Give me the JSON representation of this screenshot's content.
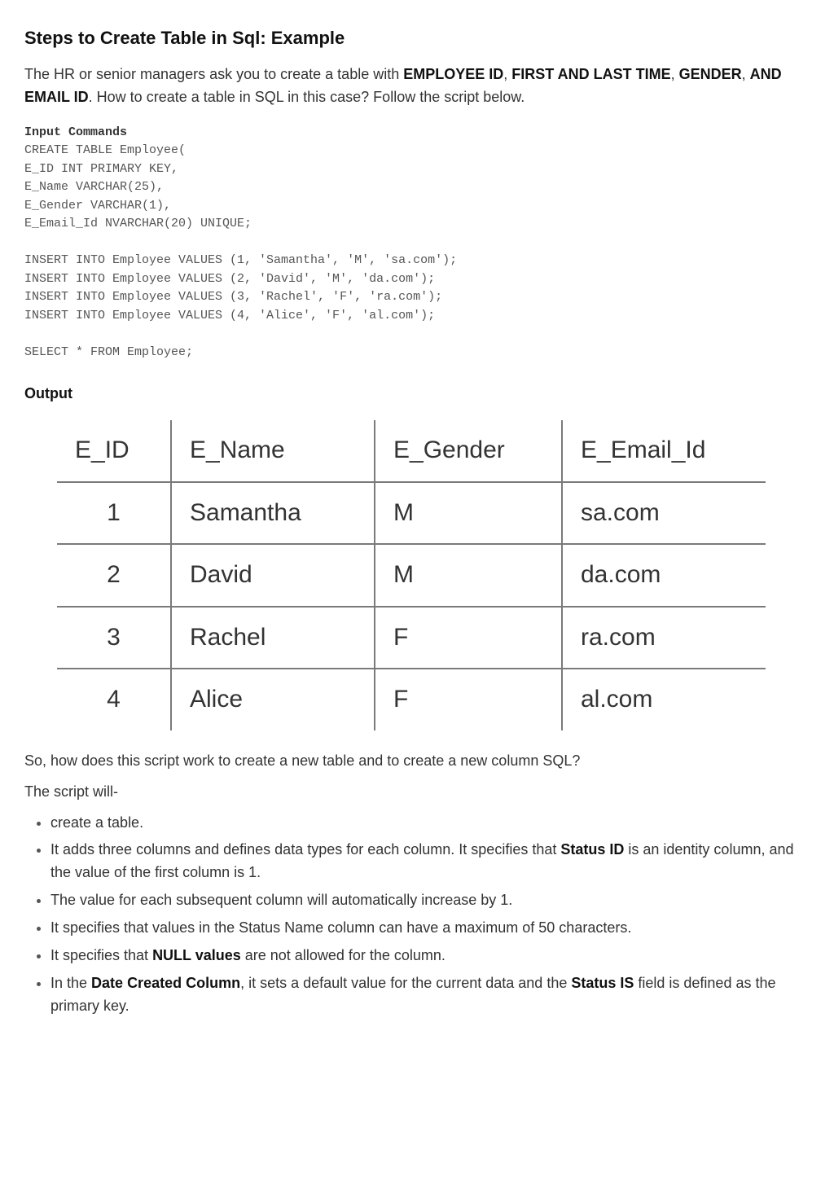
{
  "heading": "Steps to Create Table in Sql: Example",
  "intro_pre": "The HR or senior managers ask you to create a table with ",
  "intro_b1": "EMPLOYEE ID",
  "intro_s1": ", ",
  "intro_b2": "FIRST AND LAST TIME",
  "intro_s2": ", ",
  "intro_b3": "GENDER",
  "intro_s3": ", ",
  "intro_b4": "AND EMAIL ID",
  "intro_post": ". How to create a table in SQL in this case? Follow the script below.",
  "code_header": "Input Commands",
  "code_body": "CREATE TABLE Employee(\nE_ID INT PRIMARY KEY,\nE_Name VARCHAR(25),\nE_Gender VARCHAR(1),\nE_Email_Id NVARCHAR(20) UNIQUE;\n\nINSERT INTO Employee VALUES (1, 'Samantha', 'M', 'sa.com');\nINSERT INTO Employee VALUES (2, 'David', 'M', 'da.com');\nINSERT INTO Employee VALUES (3, 'Rachel', 'F', 'ra.com');\nINSERT INTO Employee VALUES (4, 'Alice', 'F', 'al.com');\n\nSELECT * FROM Employee;",
  "output_label": "Output",
  "table": {
    "headers": [
      "E_ID",
      "E_Name",
      "E_Gender",
      "E_Email_Id"
    ],
    "rows": [
      {
        "id": "1",
        "name": "Samantha",
        "gender": "M",
        "email": "sa.com"
      },
      {
        "id": "2",
        "name": "David",
        "gender": "M",
        "email": "da.com"
      },
      {
        "id": "3",
        "name": "Rachel",
        "gender": "F",
        "email": "ra.com"
      },
      {
        "id": "4",
        "name": "Alice",
        "gender": "F",
        "email": "al.com"
      }
    ]
  },
  "p_after_table": "So, how does this script work to create a new table and to create a new column SQL?",
  "p_script_will": "The script will-",
  "bullets": [
    {
      "text": "create a table."
    },
    {
      "pre": "It adds three columns and defines data types for each column. It specifies that ",
      "b": "Status ID",
      "post": " is an identity column, and the value of the first column is 1."
    },
    {
      "text": "The value for each subsequent column will automatically increase by 1."
    },
    {
      "text": "It specifies that values in the Status Name column can have a maximum of 50 characters."
    },
    {
      "pre": "It specifies that ",
      "b": "NULL values",
      "post": " are not allowed for the column."
    },
    {
      "pre": "In the ",
      "b": "Date Created Column",
      "mid": ", it sets a default value for the current data and the ",
      "b2": "Status IS",
      "post": " field is defined as the primary key."
    }
  ]
}
